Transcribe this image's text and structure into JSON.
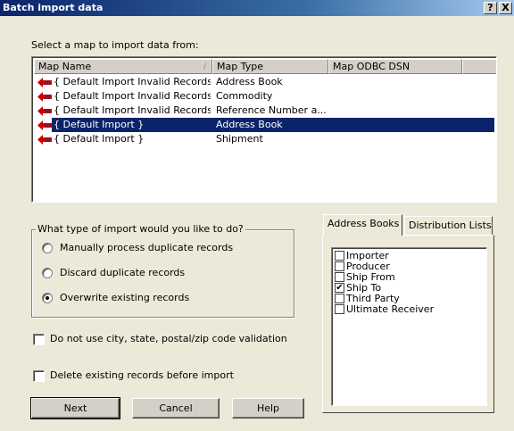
{
  "window": {
    "title": "Batch import data",
    "help_button": "?",
    "close_button": "X"
  },
  "select_map_label": "Select a map to import data from:",
  "map_list": {
    "columns": [
      "Map Name",
      "Map Type",
      "Map ODBC DSN",
      ""
    ],
    "rows": [
      {
        "name": "{ Default Import Invalid Records }",
        "type": "Address Book",
        "dsn": "",
        "selected": false
      },
      {
        "name": "{ Default Import Invalid Records }",
        "type": "Commodity",
        "dsn": "",
        "selected": false
      },
      {
        "name": "{ Default Import Invalid Records }",
        "type": "Reference Number a...",
        "dsn": "",
        "selected": false
      },
      {
        "name": "{ Default Import }",
        "type": "Address Book",
        "dsn": "",
        "selected": true
      },
      {
        "name": "{ Default Import }",
        "type": "Shipment",
        "dsn": "",
        "selected": false
      }
    ],
    "row_icon": "red-arrow-icon"
  },
  "import_type": {
    "title": "What type of import would you like to do?",
    "options": [
      {
        "label": "Manually process duplicate records",
        "checked": false
      },
      {
        "label": "Discard duplicate records",
        "checked": false
      },
      {
        "label": "Overwrite existing records",
        "checked": true
      }
    ]
  },
  "options": {
    "no_validation_label": "Do not use city, state, postal/zip code validation",
    "no_validation_checked": false,
    "delete_existing_label": "Delete existing records before import",
    "delete_existing_checked": false
  },
  "buttons": {
    "next": "Next",
    "cancel": "Cancel",
    "help": "Help"
  },
  "tabs": {
    "items": [
      "Address Books",
      "Distribution Lists"
    ],
    "active": 0,
    "address_books": [
      {
        "label": "Importer",
        "checked": false
      },
      {
        "label": "Producer",
        "checked": false
      },
      {
        "label": "Ship From",
        "checked": false
      },
      {
        "label": "Ship To",
        "checked": true
      },
      {
        "label": "Third Party",
        "checked": false
      },
      {
        "label": "Ultimate Receiver",
        "checked": false
      }
    ]
  },
  "colors": {
    "selection": "#0a246a",
    "dialog_bg": "#ece9d8",
    "arrow_red": "#cc0000"
  }
}
